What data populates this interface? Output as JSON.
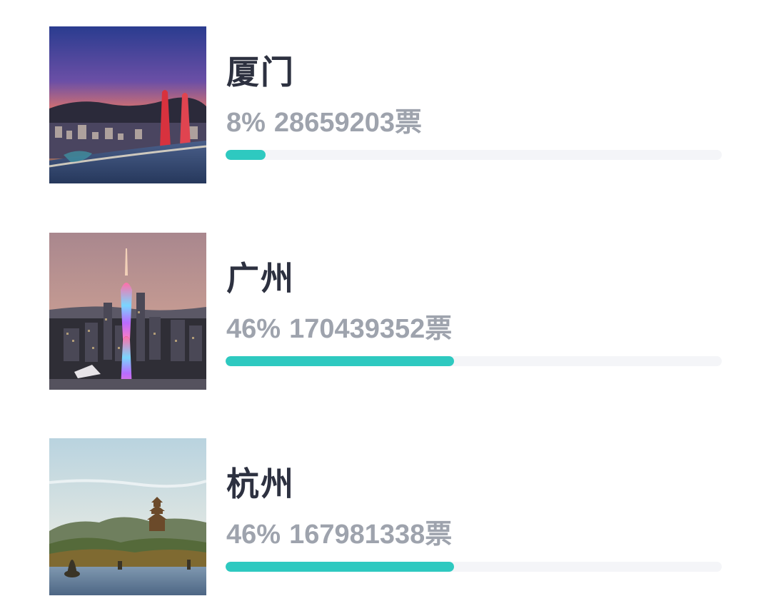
{
  "colors": {
    "accent": "#2ec9c0",
    "track": "#f4f5f8",
    "title": "#2d3140",
    "subtext": "#9ea3ad"
  },
  "ranking": {
    "items": [
      {
        "city": "厦门",
        "percent_label": "8%",
        "votes_label": "28659203票",
        "progress": 0.08,
        "thumbnail": "xiamen-twin-towers-sunset-photo"
      },
      {
        "city": "广州",
        "percent_label": "46%",
        "votes_label": "170439352票",
        "progress": 0.46,
        "thumbnail": "guangzhou-canton-tower-skyline-photo"
      },
      {
        "city": "杭州",
        "percent_label": "46%",
        "votes_label": "167981338票",
        "progress": 0.46,
        "thumbnail": "hangzhou-west-lake-leifeng-pagoda-photo"
      }
    ]
  }
}
